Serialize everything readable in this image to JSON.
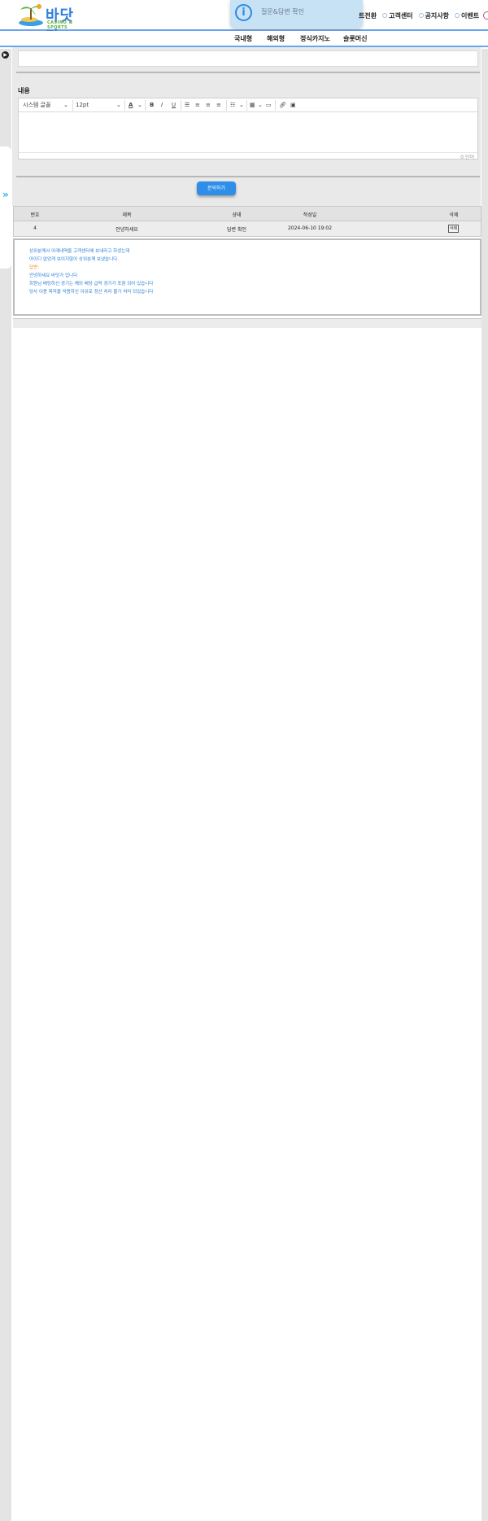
{
  "header": {
    "logo_text": "바닷가",
    "logo_sub": "CASINO & SPORTS",
    "toast_text": "질문&답변 확인",
    "nav": [
      "트전환",
      "고객센터",
      "공지사항",
      "이벤트"
    ]
  },
  "game_nav": [
    "국내형",
    "해외형",
    "정식카지노",
    "슬롯머신"
  ],
  "form": {
    "title_value": "",
    "content_label": "내용",
    "font_family": "시스템 글꼴",
    "font_size": "12pt",
    "word_count": "0 단어",
    "submit_label": "문의하기"
  },
  "table": {
    "headers": [
      "번호",
      "제목",
      "상태",
      "작성일",
      "삭제"
    ],
    "rows": [
      {
        "no": "4",
        "title": "안녕하세요",
        "status": "답변 확인",
        "date": "2024-06-10 19:02",
        "delete": "삭제"
      }
    ],
    "expanded": {
      "question": [
        "상위분께서 아래내역을 고객센터에 보내라고 하셨는데",
        "아이디 없었게 보이지않아 상위분께 보냈습니다."
      ],
      "answer_label": "답변:",
      "answer": [
        "안녕하세요 바닷가 입니다",
        "회원님 배팅하신 경기는 해외 배당 급락 경기가 포함 되어 있습니다",
        "당사 이용 목적을 악용하신 이유로 정산 처리 불가 처리 되었습니다"
      ]
    }
  },
  "colors": {
    "accent": "#2f8ee8",
    "answer": "#f08c20",
    "question": "#2a7fd6"
  }
}
